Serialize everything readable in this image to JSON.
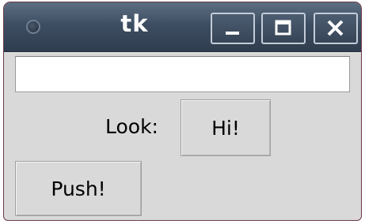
{
  "window": {
    "title": "tk"
  },
  "titlebar": {
    "buttons": {
      "minimize_icon": "minimize-icon",
      "maximize_icon": "maximize-icon",
      "close_icon": "close-icon"
    },
    "menu_icon": "window-menu-circle-icon"
  },
  "main": {
    "entry_value": "",
    "look_label": "Look:",
    "hi_button": "Hi!",
    "push_button": "Push!"
  },
  "colors": {
    "titlebar": "#3e4e62",
    "background": "#d9d9d9",
    "entry_background": "#ffffff"
  }
}
